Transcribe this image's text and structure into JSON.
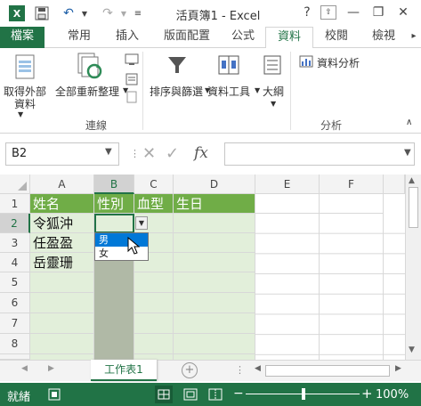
{
  "titlebar": {
    "title": "活頁簿1 - Excel",
    "help": "?",
    "minimize": "—",
    "restore": "❐",
    "close": "✕"
  },
  "tabs": [
    {
      "label": "檔案",
      "key": "file"
    },
    {
      "label": "常用",
      "key": "home"
    },
    {
      "label": "插入",
      "key": "insert"
    },
    {
      "label": "版面配置",
      "key": "layout"
    },
    {
      "label": "公式",
      "key": "formulas"
    },
    {
      "label": "資料",
      "key": "data"
    },
    {
      "label": "校閱",
      "key": "review"
    },
    {
      "label": "檢視",
      "key": "view"
    }
  ],
  "ribbon": {
    "get_external_line1": "取得外部",
    "get_external_line2": "資料",
    "refresh_all": "全部重新整理",
    "group_connections": "連線",
    "sort_filter": "排序與篩選",
    "data_tools": "資料工具",
    "outline": "大綱",
    "data_analysis": "資料分析",
    "group_analysis": "分析"
  },
  "formula_bar": {
    "name_box": "B2",
    "fx": "fx",
    "cancel": "✕",
    "enter": "✓",
    "value": ""
  },
  "columns": [
    "A",
    "B",
    "C",
    "D",
    "E",
    "F"
  ],
  "rows": [
    "1",
    "2",
    "3",
    "4",
    "5",
    "6",
    "7",
    "8"
  ],
  "cells": {
    "A1": "姓名",
    "B1": "性別",
    "C1": "血型",
    "D1": "生日",
    "A2": "令狐沖",
    "A3": "任盈盈",
    "A4": "岳靈珊"
  },
  "dropdown": {
    "options": [
      "男",
      "女"
    ],
    "highlighted": 0
  },
  "sheet": {
    "tab_label": "工作表1",
    "add": "+",
    "prev": "◀",
    "next": "▶"
  },
  "status": {
    "state": "就緒",
    "zoom": "100%",
    "zoom_out": "−",
    "zoom_in": "+"
  },
  "colors": {
    "excel_green": "#217346",
    "header_fill": "#70ad47",
    "data_fill": "#e2efda",
    "selection_blue": "#0078d7"
  }
}
